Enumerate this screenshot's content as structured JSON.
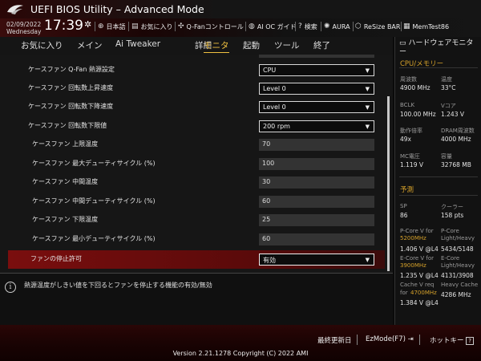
{
  "header": {
    "title": "UEFI BIOS Utility – Advanced Mode",
    "date": "02/09/2022",
    "weekday": "Wednesday",
    "time": "17:39",
    "toolbar": [
      {
        "icon": "globe-icon",
        "glyph": "⊕",
        "label": "日本語"
      },
      {
        "icon": "favorites-icon",
        "glyph": "▤",
        "label": "お気に入り"
      },
      {
        "icon": "fan-icon",
        "glyph": "✣",
        "label": "Q-Fanコントロール"
      },
      {
        "icon": "ai-oc-icon",
        "glyph": "◍",
        "label": "AI OC ガイド"
      },
      {
        "icon": "search-icon",
        "glyph": "?",
        "label": "検索"
      },
      {
        "icon": "aura-icon",
        "glyph": "✺",
        "label": "AURA"
      },
      {
        "icon": "resize-bar-icon",
        "glyph": "⬡",
        "label": "ReSize BAR"
      },
      {
        "icon": "memtest-icon",
        "glyph": "▦",
        "label": "MemTest86"
      }
    ]
  },
  "nav": {
    "items": [
      "お気に入り",
      "メイン",
      "Ai Tweaker",
      "詳細",
      "モニタ",
      "起動",
      "ツール",
      "終了"
    ],
    "active": "モニタ"
  },
  "settings": [
    {
      "label": "ケースファン Q-Fan 熱源設定",
      "value": "CPU",
      "type": "select"
    },
    {
      "label": "ケースファン 回転数上昇速度",
      "value": "Level 0",
      "type": "select"
    },
    {
      "label": "ケースファン 回転数下降速度",
      "value": "Level 0",
      "type": "select"
    },
    {
      "label": "ケースファン 回転数下限値",
      "value": "200 rpm",
      "type": "select"
    },
    {
      "label": "ケースファン 上限温度",
      "value": "70",
      "type": "input"
    },
    {
      "label": "ケースファン 最大デューティサイクル (%)",
      "value": "100",
      "type": "input"
    },
    {
      "label": "ケースファン 中間温度",
      "value": "30",
      "type": "input"
    },
    {
      "label": "ケースファン 中間デューティサイクル (%)",
      "value": "60",
      "type": "input"
    },
    {
      "label": "ケースファン 下限温度",
      "value": "25",
      "type": "input"
    },
    {
      "label": "ケースファン 最小デューティサイクル (%)",
      "value": "60",
      "type": "input"
    },
    {
      "label": "ファンの停止許可",
      "value": "有効",
      "type": "select"
    }
  ],
  "description": "熱源温度がしきい値を下回るとファンを停止する機能の有効/無効",
  "hw_monitor": {
    "title": "ハードウェアモニター",
    "cpu_section": "CPU/メモリー",
    "cpu": [
      {
        "k1": "周波数",
        "v1": "4900 MHz",
        "k2": "温度",
        "v2": "33°C"
      },
      {
        "k1": "BCLK",
        "v1": "100.00 MHz",
        "k2": "Vコア",
        "v2": "1.243 V"
      },
      {
        "k1": "動作倍率",
        "v1": "49x",
        "k2": "DRAM周波数",
        "v2": "4000 MHz"
      },
      {
        "k1": "MC電圧",
        "v1": "1.119 V",
        "k2": "容量",
        "v2": "32768 MB"
      }
    ],
    "predict_section": "予測",
    "sp_label": "SP",
    "sp_value": "86",
    "cooler_label": "クーラー",
    "cooler_value": "158 pts",
    "pcore_label": "P-Core V for",
    "pcore_freq": "5200MHz",
    "pcore_light_label": "P-Core",
    "pcore_light_label2": "Light/Heavy",
    "pcore_v": "1.406 V @L4",
    "pcore_lh": "5434/5148",
    "ecore_label": "E-Core V for",
    "ecore_freq": "3900MHz",
    "ecore_light_label": "E-Core",
    "ecore_light_label2": "Light/Heavy",
    "ecore_v": "1.235 V @L4",
    "ecore_lh": "4131/3908",
    "cache_label": "Cache V req",
    "cache_label2": "for",
    "cache_freq": "4700MHz",
    "cache_heavy_label": "Heavy Cache",
    "cache_heavy_v": "4286 MHz",
    "cache_v": "1.384 V @L4"
  },
  "footer": {
    "last_modified": "最終更新日",
    "ezmode": "EzMode(F7)",
    "ezmode_glyph": "⇥",
    "hotkey": "ホットキー",
    "hotkey_glyph": "?",
    "version": "Version 2.21.1278 Copyright (C) 2022 AMI"
  },
  "colors": {
    "accent": "#f0c040",
    "highlight": "#7a0e0e",
    "hw_accent": "#d4a02a"
  }
}
